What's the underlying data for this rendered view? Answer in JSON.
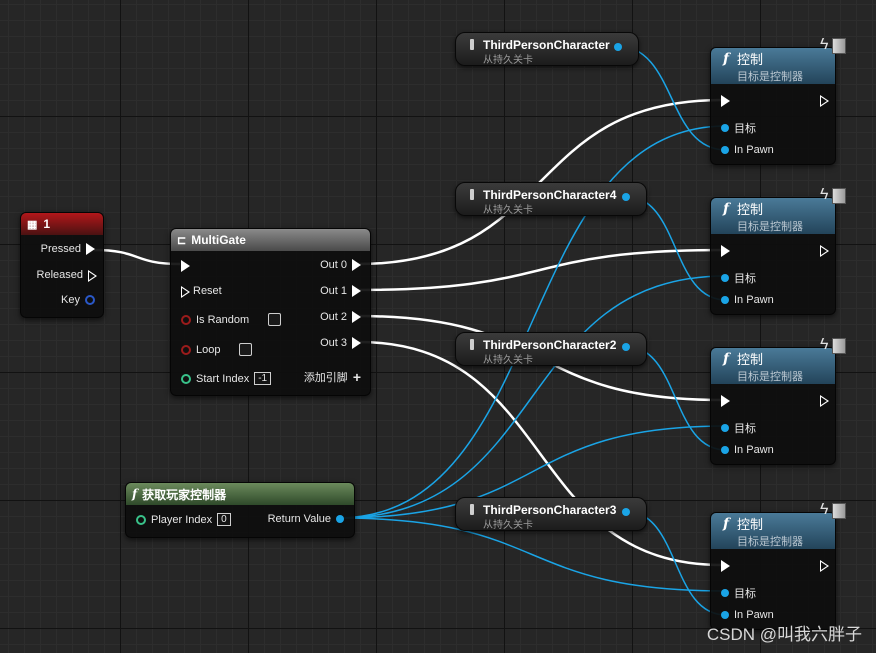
{
  "key_node": {
    "title": "1",
    "pins": [
      "Pressed",
      "Released",
      "Key"
    ]
  },
  "multigate": {
    "title": "MultiGate",
    "inputs": [
      "Reset",
      "Is Random",
      "Loop",
      "Start Index"
    ],
    "start_index_value": "-1",
    "outputs": [
      "Out 0",
      "Out 1",
      "Out 2",
      "Out 3"
    ],
    "add_pin_label": "添加引脚",
    "add_pin_icon": "plus-icon"
  },
  "get_controller": {
    "title": "获取玩家控制器",
    "player_index_label": "Player Index",
    "player_index_value": "0",
    "return_label": "Return Value"
  },
  "vars": [
    {
      "name": "ThirdPersonCharacter",
      "sub": "从持久关卡"
    },
    {
      "name": "ThirdPersonCharacter4",
      "sub": "从持久关卡"
    },
    {
      "name": "ThirdPersonCharacter2",
      "sub": "从持久关卡"
    },
    {
      "name": "ThirdPersonCharacter3",
      "sub": "从持久关卡"
    }
  ],
  "possess_nodes": [
    {
      "title": "控制",
      "subtitle": "目标是控制器",
      "target_label": "目标",
      "pawn_label": "In Pawn"
    },
    {
      "title": "控制",
      "subtitle": "目标是控制器",
      "target_label": "目标",
      "pawn_label": "In Pawn"
    },
    {
      "title": "控制",
      "subtitle": "目标是控制器",
      "target_label": "目标",
      "pawn_label": "In Pawn"
    },
    {
      "title": "控制",
      "subtitle": "目标是控制器",
      "target_label": "目标",
      "pawn_label": "In Pawn"
    }
  ],
  "watermark": "CSDN @叫我六胖子",
  "colors": {
    "exec_wire": "#ffffff",
    "object_wire": "#1aa4e6",
    "key_header": "#b3171a",
    "function_header": "#4a7a98",
    "pure_header": "#6b8a5c"
  }
}
